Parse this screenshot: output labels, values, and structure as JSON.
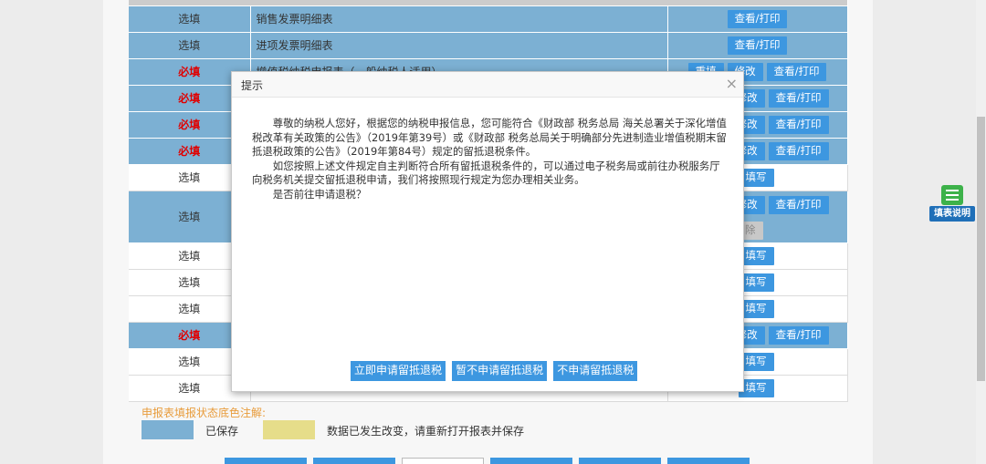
{
  "rows": [
    {
      "type": "选填",
      "required": false,
      "name": "销售发票明细表",
      "buttons": [
        "查看/打印"
      ]
    },
    {
      "type": "选填",
      "required": false,
      "name": "进项发票明细表",
      "buttons": [
        "查看/打印"
      ]
    },
    {
      "type": "必填",
      "required": true,
      "name": "增值税纳税申报表（一般纳税人适用）",
      "buttons": [
        "重填",
        "修改",
        "查看/打印"
      ]
    },
    {
      "type": "必填",
      "required": true,
      "name": "",
      "buttons": [
        "修改",
        "查看/打印"
      ]
    },
    {
      "type": "必填",
      "required": true,
      "name": "",
      "buttons": [
        "修改",
        "查看/打印"
      ]
    },
    {
      "type": "必填",
      "required": true,
      "name": "",
      "buttons": [
        "修改",
        "查看/打印"
      ]
    },
    {
      "type": "选填",
      "required": false,
      "name": "",
      "buttons": [
        "填写"
      ]
    },
    {
      "type": "选填",
      "required": false,
      "name": "",
      "buttons": [
        "修改",
        "查看/打印",
        "删除"
      ]
    },
    {
      "type": "选填",
      "required": false,
      "name": "",
      "buttons": [
        "填写"
      ]
    },
    {
      "type": "选填",
      "required": false,
      "name": "",
      "buttons": [
        "填写"
      ]
    },
    {
      "type": "选填",
      "required": false,
      "name": "",
      "buttons": [
        "填写"
      ]
    },
    {
      "type": "必填",
      "required": true,
      "name": "",
      "buttons": [
        "修改",
        "查看/打印"
      ]
    },
    {
      "type": "选填",
      "required": false,
      "name": "",
      "buttons": [
        "填写"
      ]
    },
    {
      "type": "选填",
      "required": false,
      "name": "",
      "buttons": [
        "填写"
      ]
    }
  ],
  "legend": {
    "title": "申报表填报状态底色注解:",
    "saved": "已保存",
    "changed": "数据已发生改变，请重新打开报表并保存"
  },
  "side_widget": {
    "label": "填表说明",
    "icon": "form-guide-icon"
  },
  "modal": {
    "title": "提示",
    "close": "×",
    "paragraph1": "尊敬的纳税人您好，根据您的纳税申报信息，您可能符合《财政部 税务总局 海关总署关于深化增值税改革有关政策的公告》（2019年第39号）或《财政部 税务总局关于明确部分先进制造业增值税期末留抵退税政策的公告》（2019年第84号）规定的留抵退税条件。",
    "paragraph2": "如您按照上述文件规定自主判断符合所有留抵退税条件的，可以通过电子税务局或前往办税服务厅向税务机关提交留抵退税申请，我们将按照现行规定为您办理相关业务。",
    "paragraph3": "是否前往申请退税？",
    "buttons": [
      "立即申请留抵退税",
      "暂不申请留抵退税",
      "不申请留抵退税"
    ]
  },
  "colors": {
    "saved": "#7cb0d3",
    "changed": "#e6dd8a",
    "button": "#3d97e0",
    "required": "#e00000"
  }
}
